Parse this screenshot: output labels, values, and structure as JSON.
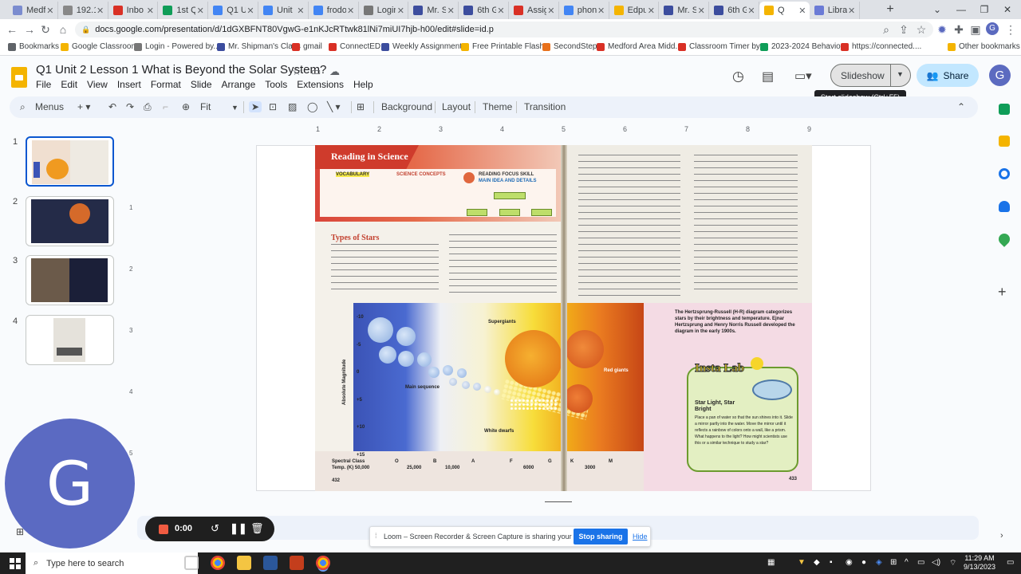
{
  "browser": {
    "tabs": [
      {
        "label": "Medf",
        "color": "#7b8ccf"
      },
      {
        "label": "192.1",
        "color": "#888888"
      },
      {
        "label": "Inbo",
        "color": "#d93025"
      },
      {
        "label": "1st Q",
        "color": "#0f9d58"
      },
      {
        "label": "Q1 U",
        "color": "#4285f4"
      },
      {
        "label": "Unit",
        "color": "#4285f4"
      },
      {
        "label": "frodo",
        "color": "#4285f4"
      },
      {
        "label": "Login",
        "color": "#777777"
      },
      {
        "label": "Mr. S",
        "color": "#3c4d9e"
      },
      {
        "label": "6th G",
        "color": "#3c4d9e"
      },
      {
        "label": "Assig",
        "color": "#d93025"
      },
      {
        "label": "phon",
        "color": "#4285f4"
      },
      {
        "label": "Edpu",
        "color": "#f4b400"
      },
      {
        "label": "Mr. S",
        "color": "#3c4d9e"
      },
      {
        "label": "6th G",
        "color": "#3c4d9e"
      },
      {
        "label": "Q",
        "color": "#f4b400"
      },
      {
        "label": "Libra",
        "color": "#6b7bd6"
      }
    ],
    "url": "docs.google.com/presentation/d/1dGXBFNT80VgwG-e1nKJcRTtwk81lNi7miUI7hjb-h00/edit#slide=id.p",
    "bookmarks": [
      {
        "label": "Bookmarks",
        "color": "#5f6368"
      },
      {
        "label": "Google Classroom",
        "color": "#f4b400"
      },
      {
        "label": "Login - Powered by...",
        "color": "#777777"
      },
      {
        "label": "Mr. Shipman's Class",
        "color": "#3c4d9e"
      },
      {
        "label": "gmail",
        "color": "#d93025"
      },
      {
        "label": "ConnectED",
        "color": "#d93025"
      },
      {
        "label": "Weekly Assignments",
        "color": "#3c4d9e"
      },
      {
        "label": "Free Printable Flash...",
        "color": "#f4b400"
      },
      {
        "label": "SecondStep",
        "color": "#e8711c"
      },
      {
        "label": "Medford Area Midd...",
        "color": "#d93025"
      },
      {
        "label": "Classroom Timer by...",
        "color": "#d93025"
      },
      {
        "label": "2023-2024 Behavio...",
        "color": "#0f9d58"
      },
      {
        "label": "https://connected....",
        "color": "#d93025"
      },
      {
        "label": "Other bookmarks",
        "color": "#f4b400"
      }
    ]
  },
  "docs": {
    "title": "Q1 Unit 2 Lesson 1 What is Beyond the Solar System?",
    "menu": [
      "File",
      "Edit",
      "View",
      "Insert",
      "Format",
      "Slide",
      "Arrange",
      "Tools",
      "Extensions",
      "Help"
    ],
    "slideshow_label": "Slideshow",
    "share_label": "Share",
    "avatar_letter": "G",
    "tooltip": "Start slideshow (Ctrl+F5)",
    "toolbar": {
      "menus": "Menus",
      "zoom": "Fit",
      "background": "Background",
      "layout": "Layout",
      "theme": "Theme",
      "transition": "Transition"
    },
    "slide_numbers": [
      "1",
      "2",
      "3",
      "4"
    ],
    "ruler_h": [
      "1",
      "2",
      "3",
      "4",
      "5",
      "6",
      "7",
      "8",
      "9"
    ],
    "ruler_v": [
      "1",
      "2",
      "3",
      "4",
      "5"
    ]
  },
  "book": {
    "ribbon": "Reading in Science",
    "vocab_title": "VOCABULARY",
    "concepts_title": "SCIENCE CONCEPTS",
    "focus_title": "READING FOCUS SKILL",
    "main_idea": "MAIN IDEA AND DETAILS",
    "types_heading": "Types of Stars",
    "hr_caption": "The Hertzsprung-Russell (H-R) diagram categorizes stars by their brightness and temperature. Ejnar Hertzsprung and Henry Norris Russell developed the diagram in the early 1900s.",
    "axis_label": "Absolute Magnitude",
    "magnitudes": [
      "-10",
      "-5",
      "0",
      "+5",
      "+10",
      "+15"
    ],
    "spectral_label": "Spectral Class",
    "temp_label": "Temp. (K) 50,000",
    "classes": [
      "O",
      "B",
      "A",
      "F",
      "G",
      "K",
      "M"
    ],
    "temps": [
      "25,000",
      "10,000",
      "6000",
      "3000"
    ],
    "supergiants": "Supergiants",
    "red_giants": "Red giants",
    "main_sequence": "Main sequence",
    "white_dwarfs": "White dwarfs",
    "insta_title": "Insta Lab",
    "insta_sub": "Star Light, Star Bright",
    "insta_text": "Place a pan of water so that the sun shines into it. Slide a mirror partly into the water. Move the mirror until it reflects a rainbow of colors onto a wall, like a prism. What happens to the light? How might scientists use this or a similar technique to study a star?",
    "page_left": "432",
    "page_right": "433"
  },
  "recorder": {
    "time": "0:00"
  },
  "loom": {
    "message": "Loom – Screen Recorder & Screen Capture is sharing your screen.",
    "stop": "Stop sharing",
    "hide": "Hide"
  },
  "taskbar": {
    "search_placeholder": "Type here to search",
    "time": "11:29 AM",
    "date": "9/13/2023"
  },
  "big_avatar_letter": "G"
}
